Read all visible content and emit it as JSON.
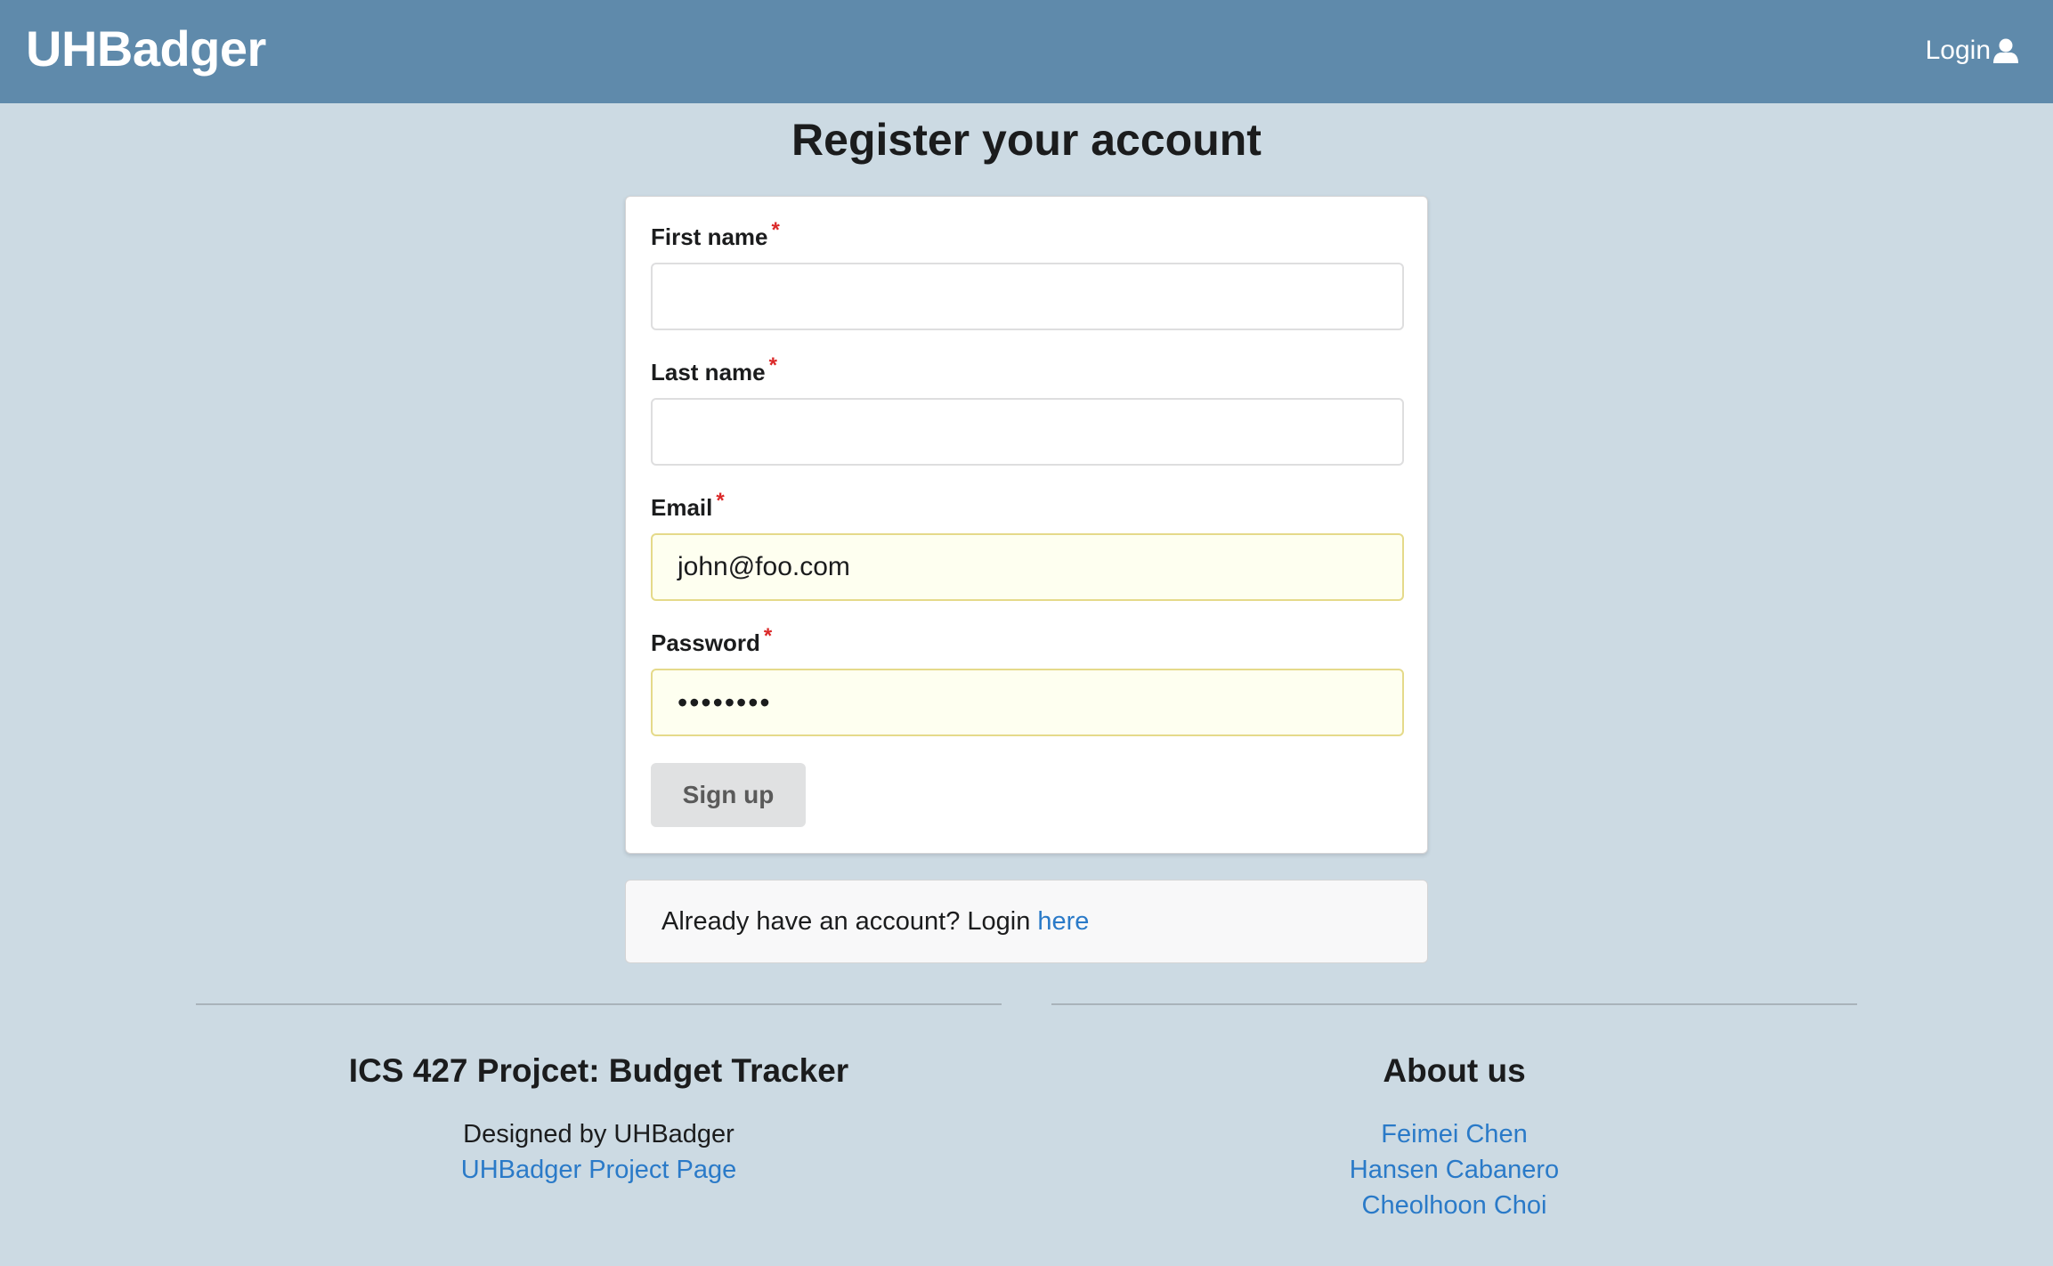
{
  "navbar": {
    "brand": "UHBadger",
    "login_label": "Login",
    "login_icon": "user-icon"
  },
  "page": {
    "title": "Register your account"
  },
  "form": {
    "first_name_label": "First name",
    "first_name_value": "",
    "last_name_label": "Last name",
    "last_name_value": "",
    "email_label": "Email",
    "email_value": "john@foo.com",
    "password_label": "Password",
    "password_value": "••••••••",
    "required_marker": "*",
    "submit_label": "Sign up"
  },
  "login_message": {
    "text": "Already have an account? Login",
    "link_label": "here"
  },
  "footer": {
    "project": {
      "heading": "ICS 427 Projcet: Budget Tracker",
      "designed_by": "Designed by UHBadger",
      "project_link": "UHBadger Project Page"
    },
    "about": {
      "heading": "About us",
      "members": [
        "Feimei Chen",
        "Hansen Cabanero",
        "Cheolhoon Choi"
      ]
    }
  },
  "colors": {
    "navbar": "#5f8aab",
    "background": "#ccdae3",
    "link": "#2a7ac8",
    "required": "#db2828",
    "autofill": "#fefff0"
  }
}
